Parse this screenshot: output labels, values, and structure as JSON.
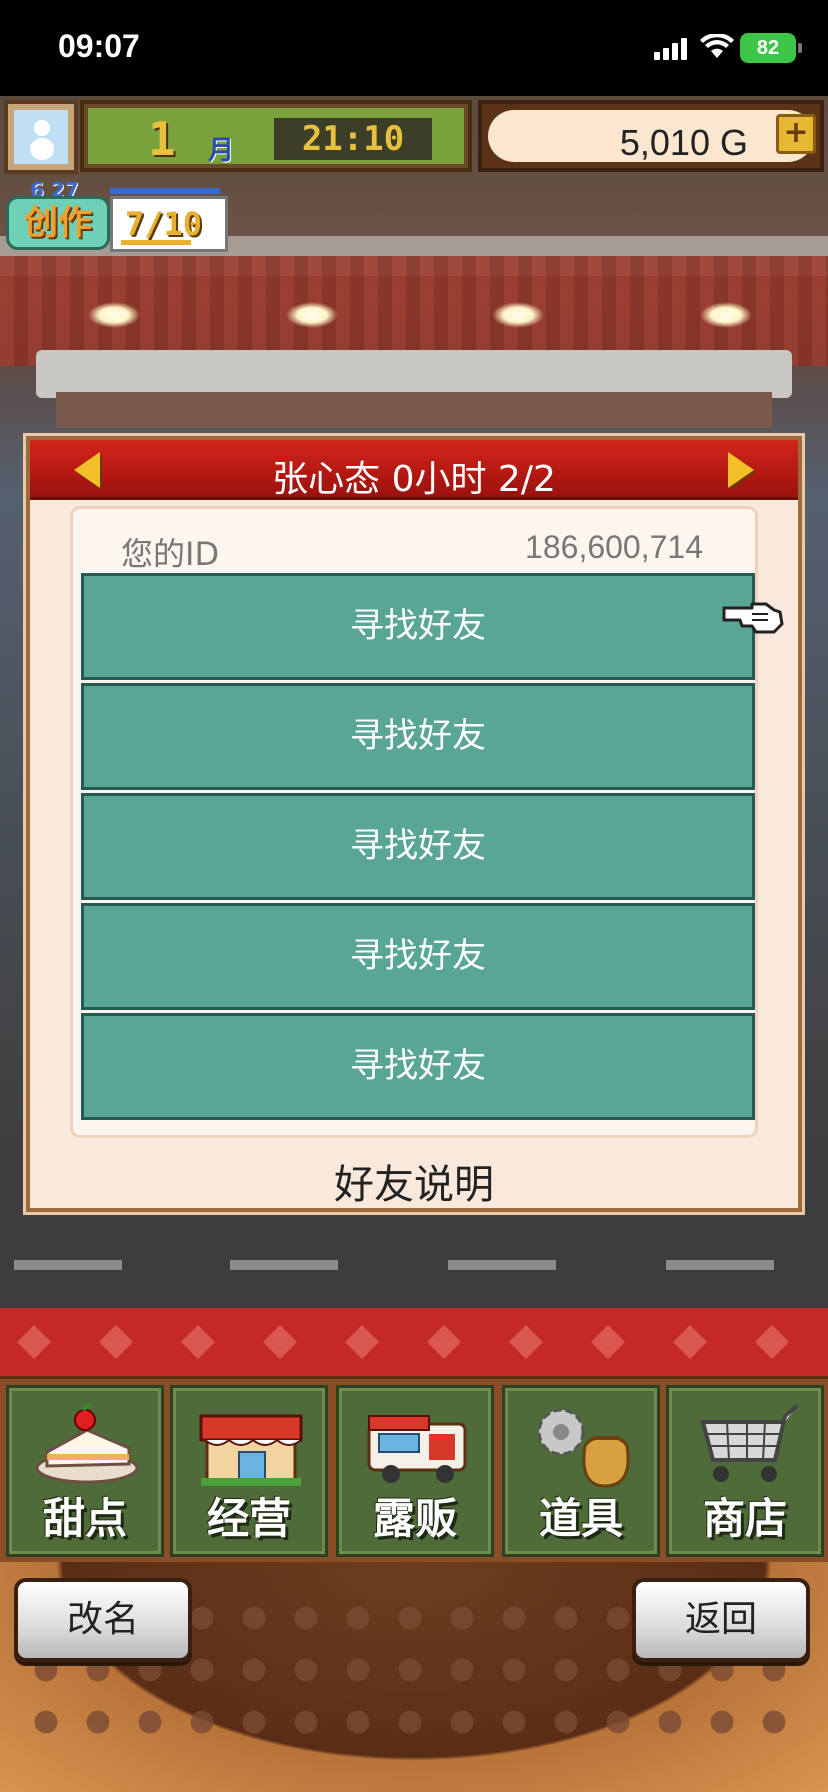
{
  "status_bar": {
    "time": "09:07",
    "battery": "82",
    "battery_color": "#3ec64a"
  },
  "hud": {
    "avatar_icon": "snowman-icon",
    "month_number": "1",
    "month_label": "月",
    "clock": "21:10",
    "money": "5,010",
    "currency": "G",
    "add_money_label": "+",
    "create": {
      "label": "创作",
      "date": "6 27",
      "count": "7/10"
    }
  },
  "dialog": {
    "title": "张心态  0小时 2/2",
    "id_label": "您的ID",
    "id_value": "186,600,714",
    "friend_slots": [
      {
        "label": "寻找好友"
      },
      {
        "label": "寻找好友"
      },
      {
        "label": "寻找好友"
      },
      {
        "label": "寻找好友"
      },
      {
        "label": "寻找好友"
      }
    ],
    "help_label": "好友说明",
    "title_bar_color": "#c21f17",
    "slot_color": "#59a697"
  },
  "menu": {
    "items": [
      {
        "label": "甜点",
        "icon": "cake-icon"
      },
      {
        "label": "经营",
        "icon": "shop-building-icon"
      },
      {
        "label": "露贩",
        "icon": "food-truck-icon"
      },
      {
        "label": "道具",
        "icon": "gear-bag-icon"
      },
      {
        "label": "商店",
        "icon": "shopping-cart-icon"
      }
    ]
  },
  "footer": {
    "rename_label": "改名",
    "back_label": "返回"
  }
}
